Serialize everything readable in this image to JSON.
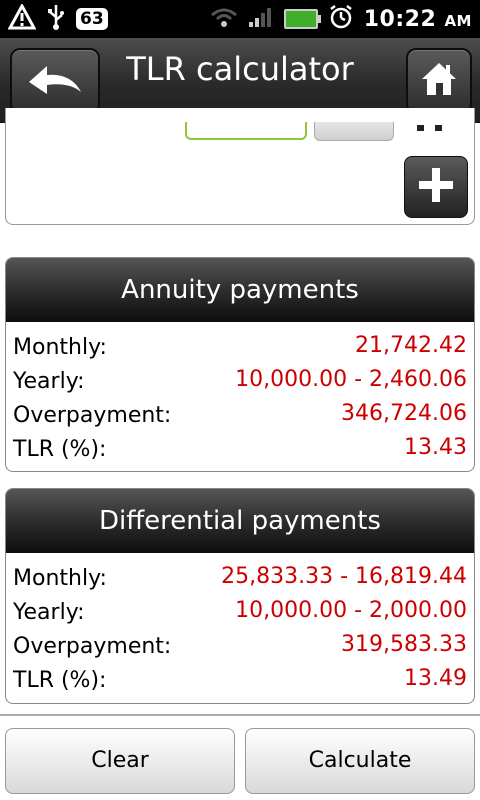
{
  "status_bar": {
    "notification_count": "63",
    "time": "10:22",
    "ampm": "AM"
  },
  "header": {
    "title": "TLR calculator"
  },
  "annuity": {
    "title": "Annuity payments",
    "rows": [
      {
        "label": "Monthly:",
        "value": "21,742.42"
      },
      {
        "label": "Yearly:",
        "value": "10,000.00 - 2,460.06"
      },
      {
        "label": "Overpayment:",
        "value": "346,724.06"
      },
      {
        "label": "TLR (%):",
        "value": "13.43"
      }
    ]
  },
  "differential": {
    "title": "Differential payments",
    "rows": [
      {
        "label": "Monthly:",
        "value": "25,833.33 - 16,819.44"
      },
      {
        "label": "Yearly:",
        "value": "10,000.00 - 2,000.00"
      },
      {
        "label": "Overpayment:",
        "value": "319,583.33"
      },
      {
        "label": "TLR (%):",
        "value": "13.49"
      }
    ]
  },
  "actions": {
    "clear_label": "Clear",
    "calculate_label": "Calculate"
  },
  "colors": {
    "value_red": "#cc0000",
    "accent_green": "#8fc43c"
  }
}
